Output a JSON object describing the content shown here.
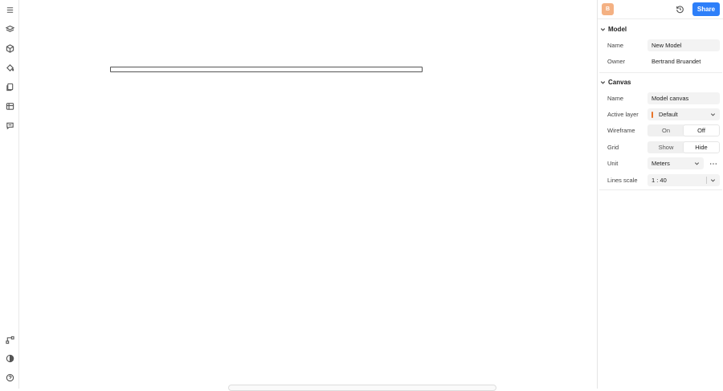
{
  "left_rail": {
    "top_icons": [
      "menu-icon",
      "layers-icon",
      "cube-icon",
      "paint-icon",
      "pages-icon",
      "table-icon",
      "comments-icon"
    ],
    "bottom_icons": [
      "flow-icon",
      "theme-icon",
      "help-icon"
    ]
  },
  "header": {
    "avatar_initial": "B",
    "share_label": "Share"
  },
  "model": {
    "title": "Model",
    "name_label": "Name",
    "name_value": "New Model",
    "owner_label": "Owner",
    "owner_value": "Bertrand Bruandet"
  },
  "canvas": {
    "title": "Canvas",
    "name_label": "Name",
    "name_value": "Model canvas",
    "layer_label": "Active layer",
    "layer_value": "Default",
    "layer_color": "#e8742a",
    "wireframe_label": "Wireframe",
    "wireframe_on": "On",
    "wireframe_off": "Off",
    "wireframe_selected": "Off",
    "grid_label": "Grid",
    "grid_show": "Show",
    "grid_hide": "Hide",
    "grid_selected": "Hide",
    "unit_label": "Unit",
    "unit_value": "Meters",
    "lines_scale_label": "Lines scale",
    "lines_scale_value": "1 : 40"
  },
  "colors": {
    "accent": "#2d7ff9",
    "avatar_bg": "#f4b183"
  }
}
